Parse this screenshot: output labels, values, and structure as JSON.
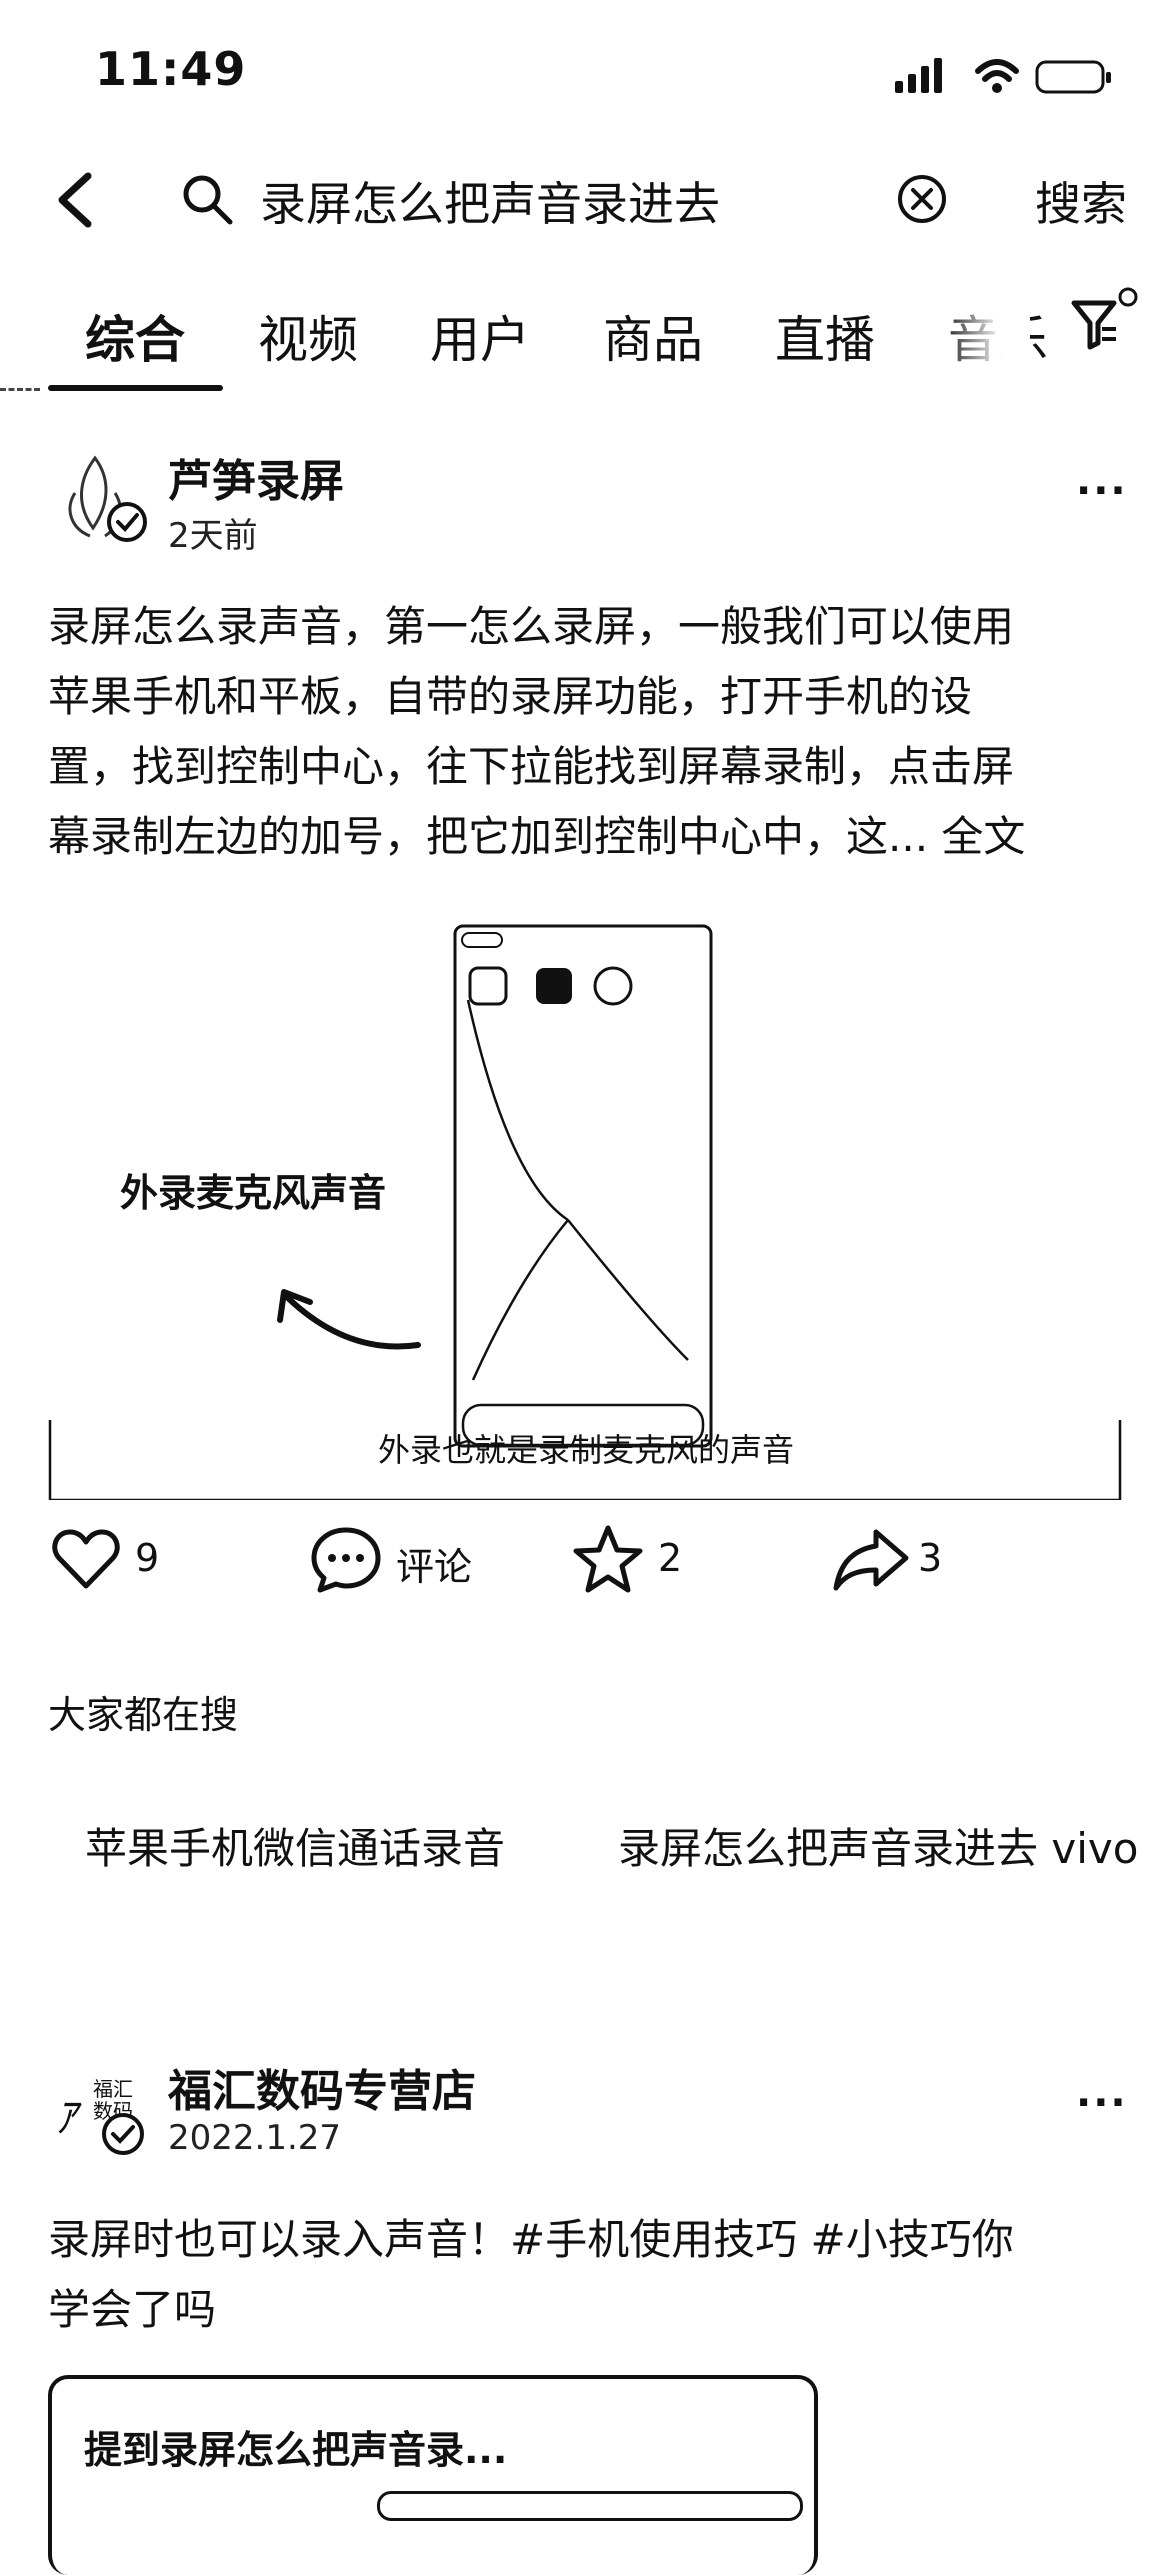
{
  "status_bar": {
    "time": "11:49"
  },
  "search": {
    "query": "录屏怎么把声音录进去",
    "submit_label": "搜索"
  },
  "tabs": [
    {
      "label": "综合",
      "active": true
    },
    {
      "label": "视频"
    },
    {
      "label": "用户"
    },
    {
      "label": "商品"
    },
    {
      "label": "直播"
    },
    {
      "label": "音乐"
    }
  ],
  "post1": {
    "author": "芦笋录屏",
    "time": "2天前",
    "text_lines": [
      "录屏怎么录声音，第一怎么录屏，一般我们可以使用",
      "苹果手机和平板，自带的录屏功能，打开手机的设",
      "置，找到控制中心，往下拉能找到屏幕录制，点击屏",
      "幕录制左边的加号，把它加到控制中心中，这..."
    ],
    "more_text": "全文",
    "video": {
      "left_caption": "外录麦克风声音",
      "subtitle": "外录也就是录制麦克风的声音"
    },
    "actions": {
      "likes": "9",
      "comment_label": "评论",
      "favorites": "2",
      "shares": "3"
    }
  },
  "search_suggestions": {
    "title": "大家都在搜",
    "items": [
      "苹果手机微信通话录音",
      "录屏怎么把声音录进去 vivo"
    ]
  },
  "post2": {
    "author": "福汇数码专营店",
    "time": "2022.1.27",
    "text_lines": [
      "录屏时也可以录入声音！#手机使用技巧 #小技巧你",
      "学会了吗"
    ],
    "video": {
      "caption": "提到录屏怎么把声音录..."
    }
  },
  "colors": {
    "text": "#111111",
    "background": "#ffffff"
  }
}
